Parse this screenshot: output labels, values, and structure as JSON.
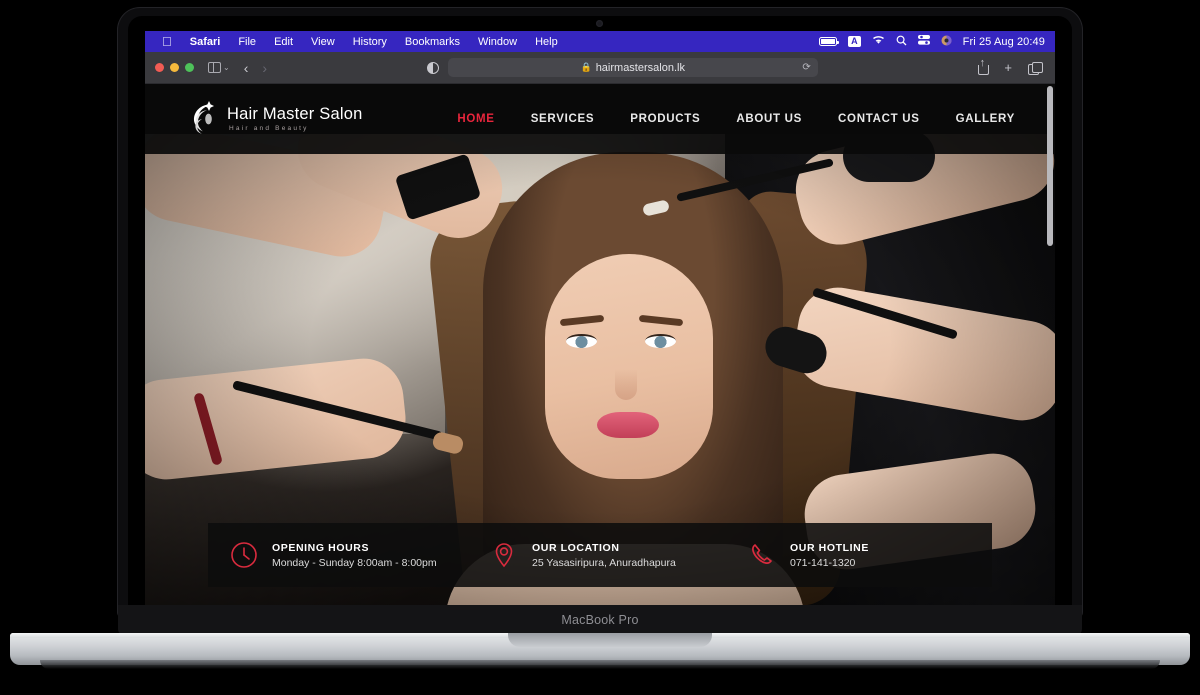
{
  "device": {
    "label": "MacBook Pro"
  },
  "menubar": {
    "apple": "apple-logo",
    "items": [
      "Safari",
      "File",
      "Edit",
      "View",
      "History",
      "Bookmarks",
      "Window",
      "Help"
    ],
    "status": {
      "battery": "battery-icon",
      "input_source": "A",
      "wifi": "wifi-icon",
      "search": "search-icon",
      "control_center": "control-center-icon",
      "siri": "siri-icon",
      "clock": "Fri 25 Aug  20:49"
    }
  },
  "browser": {
    "traffic_lights": [
      "close",
      "minimize",
      "zoom"
    ],
    "sidebar_toggle": "sidebar-icon",
    "tab_overview_chevron": "⌄",
    "back": "‹",
    "forward": "›",
    "reader_icon": "reader-view-icon",
    "url": "hairmastersalon.lk",
    "lock": "🔒",
    "reload": "⟳",
    "share": "share-icon",
    "new_tab": "+",
    "tabs": "tabs-icon"
  },
  "site": {
    "logo": {
      "title": "Hair Master Salon",
      "subtitle": "Hair and Beauty"
    },
    "nav": [
      {
        "label": "HOME",
        "active": true
      },
      {
        "label": "SERVICES",
        "active": false
      },
      {
        "label": "PRODUCTS",
        "active": false
      },
      {
        "label": "ABOUT US",
        "active": false
      },
      {
        "label": "CONTACT US",
        "active": false
      },
      {
        "label": "GALLERY",
        "active": false
      }
    ],
    "hero": {
      "alt": "salon-hero-image"
    },
    "info": [
      {
        "icon": "clock-icon",
        "title": "OPENING HOURS",
        "value": "Monday - Sunday 8:00am - 8:00pm"
      },
      {
        "icon": "location-pin-icon",
        "title": "OUR LOCATION",
        "value": "25 Yasasiripura, Anuradhapura"
      },
      {
        "icon": "phone-icon",
        "title": "OUR HOTLINE",
        "value": "071-141-1320"
      }
    ]
  },
  "colors": {
    "accent_red": "#e8253c",
    "menubar_blue": "#3626c0",
    "toolbar_gray": "#3a3a3e"
  }
}
